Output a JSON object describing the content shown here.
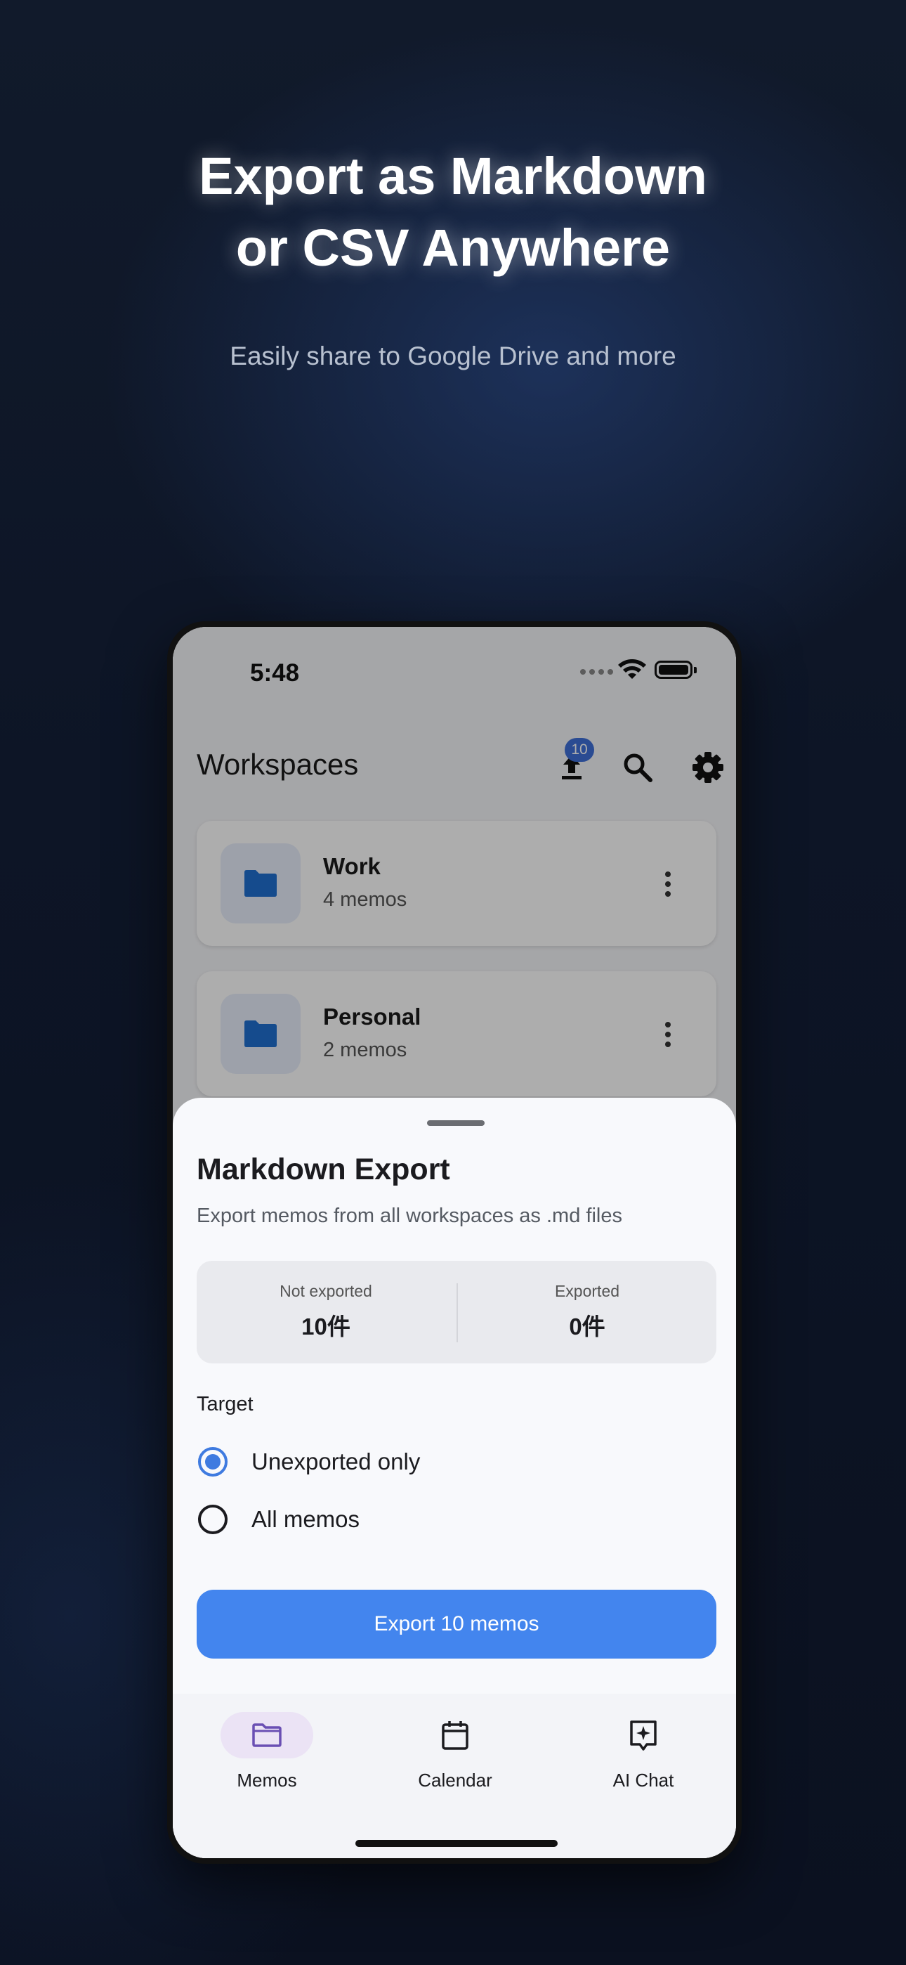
{
  "promo": {
    "headline_line1": "Export as Markdown",
    "headline_line2": "or CSV Anywhere",
    "subline": "Easily share to Google Drive and more"
  },
  "status_bar": {
    "time": "5:48"
  },
  "app_bar": {
    "title": "Workspaces",
    "upload_badge": "10",
    "icons": [
      "upload-icon",
      "search-icon",
      "gear-icon"
    ]
  },
  "workspaces": [
    {
      "name": "Work",
      "count": "4 memos"
    },
    {
      "name": "Personal",
      "count": "2 memos"
    }
  ],
  "sheet": {
    "title": "Markdown Export",
    "description": "Export memos from all workspaces as .md files",
    "stats": {
      "not_exported_label": "Not exported",
      "not_exported_value": "10件",
      "exported_label": "Exported",
      "exported_value": "0件"
    },
    "target_label": "Target",
    "options": [
      {
        "label": "Unexported only",
        "selected": true
      },
      {
        "label": "All memos",
        "selected": false
      }
    ],
    "export_button": "Export 10 memos"
  },
  "bottom_nav": [
    {
      "label": "Memos",
      "icon": "folder-icon",
      "active": true
    },
    {
      "label": "Calendar",
      "icon": "calendar-icon",
      "active": false
    },
    {
      "label": "AI Chat",
      "icon": "ai-chat-icon",
      "active": false
    }
  ],
  "colors": {
    "accent": "#4385ee",
    "badge": "#3f6fd8",
    "nav_active": "#ebe3f5",
    "folder_blue": "#1f6fd0",
    "nav_folder": "#6a4fb3"
  }
}
